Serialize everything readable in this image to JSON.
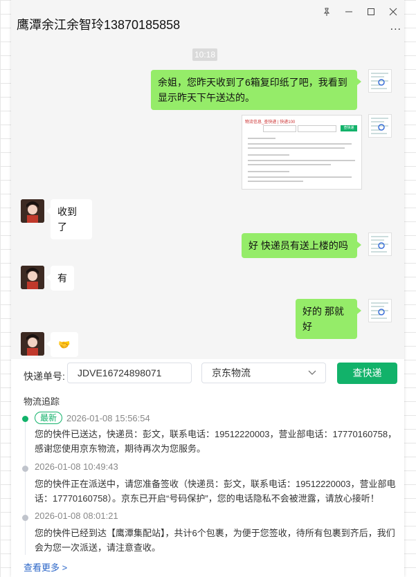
{
  "window": {
    "title": "鹰潭余江余智玲13870185858",
    "controls": [
      "pin-icon",
      "minimize-icon",
      "maximize-icon",
      "close-icon"
    ],
    "more_label": "..."
  },
  "chat": {
    "time": "10:18",
    "messages": [
      {
        "from": "me",
        "text": "余姐，您昨天收到了6箱复印纸了吧，我看到显示昨天下午送达的。"
      },
      {
        "from": "me",
        "type": "image",
        "image_title": "物流信息_查快递 | 快递100",
        "image_button": "查快递"
      },
      {
        "from": "other",
        "text": "收到了"
      },
      {
        "from": "me",
        "text": "好   快递员有送上楼的吗"
      },
      {
        "from": "other",
        "text": "有"
      },
      {
        "from": "me",
        "text": "好的 那就好"
      },
      {
        "from": "other",
        "text": "🤝"
      }
    ]
  },
  "tracker": {
    "number_label": "快递单号:",
    "number_value": "JDVE16724898071",
    "carrier": "京东物流",
    "query_button": "查快递",
    "section_title": "物流追踪",
    "events": [
      {
        "latest_badge": "最新",
        "time": "2026-01-08 15:56:54",
        "text": "您的快件已送达，快递员：彭文，联系电话：19512220003，营业部电话：17770160758，感谢您使用京东物流，期待再次为您服务。"
      },
      {
        "time": "2026-01-08 10:49:43",
        "text": "您的快件正在派送中，请您准备签收（快递员：彭文，联系电话：19512220003，营业部电话：17770160758）。京东已开启“号码保护”，您的电话隐私不会被泄露，请放心接听！"
      },
      {
        "time": "2026-01-08 08:01:21",
        "text": "您的快件已经到达【鹰潭集配站】，共计6个包裹，为便于您签收，待所有包裹到齐后，我们会为您一次派送，请注意查收。"
      }
    ],
    "see_more": "查看更多 >"
  },
  "colors": {
    "my_bubble": "#95ec69",
    "accent_green": "#12b26a",
    "link_blue": "#2b66c8"
  }
}
